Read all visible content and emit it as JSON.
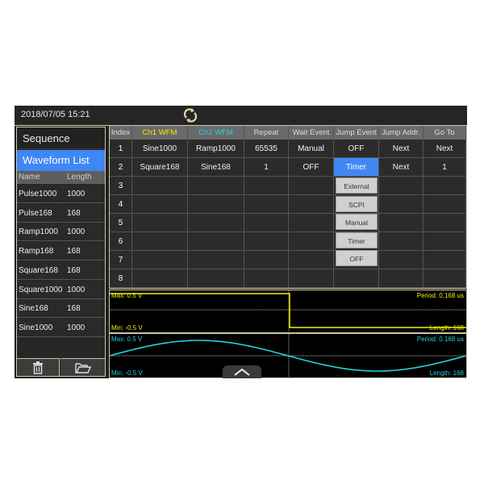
{
  "topbar": {
    "datetime": "2018/07/05 15:21",
    "refresh_icon": "refresh-icon"
  },
  "left_panel": {
    "sequence_label": "Sequence",
    "waveform_list_label": "Waveform List",
    "columns": [
      "Name",
      "Length"
    ],
    "items": [
      {
        "name": "Pulse1000",
        "length": "1000"
      },
      {
        "name": "Pulse168",
        "length": "168"
      },
      {
        "name": "Ramp1000",
        "length": "1000"
      },
      {
        "name": "Ramp168",
        "length": "168"
      },
      {
        "name": "Square168",
        "length": "168"
      },
      {
        "name": "Square1000",
        "length": "1000"
      },
      {
        "name": "Sine168",
        "length": "168"
      },
      {
        "name": "Sine1000",
        "length": "1000"
      }
    ],
    "buttons": [
      {
        "icon": "trash-icon"
      },
      {
        "icon": "folder-open-icon"
      }
    ]
  },
  "sequence_table": {
    "columns": [
      "Index",
      "Ch1 WFM",
      "Ch2 WFM",
      "Repeat",
      "Wait Event",
      "Jump Event",
      "Jump Addr.",
      "Go To"
    ],
    "column_colors": {
      "Ch1 WFM": "#f0f000",
      "Ch2 WFM": "#22d3e0"
    },
    "rows": [
      [
        "1",
        "Sine1000",
        "Ramp1000",
        "65535",
        "Manual",
        "OFF",
        "Next",
        "Next"
      ],
      [
        "2",
        "Square168",
        "Sine168",
        "1",
        "OFF",
        "Timer",
        "Next",
        "1"
      ],
      [
        "3",
        "",
        "",
        "",
        "",
        "",
        "",
        ""
      ],
      [
        "4",
        "",
        "",
        "",
        "",
        "",
        "",
        ""
      ],
      [
        "5",
        "",
        "",
        "",
        "",
        "",
        "",
        ""
      ],
      [
        "6",
        "",
        "",
        "",
        "",
        "",
        "",
        ""
      ],
      [
        "7",
        "",
        "",
        "",
        "",
        "",
        "",
        ""
      ],
      [
        "8",
        "",
        "",
        "",
        "",
        "",
        "",
        ""
      ]
    ],
    "selected_cell": {
      "row": 2,
      "column": "Jump Event",
      "value": "Timer"
    },
    "jump_event_dropdown": [
      "External",
      "SCPI",
      "Manual",
      "Timer",
      "OFF"
    ]
  },
  "ch1_preview": {
    "max": "Max: 0.5 V",
    "min": "Min: -0.5 V",
    "period": "Period: 0.168 us",
    "length": "Length: 168",
    "color": "#f0f000"
  },
  "ch2_preview": {
    "max": "Max: 0.5 V",
    "min": "Min: -0.5 V",
    "period": "Period: 0.168 us",
    "length": "Length: 168",
    "color": "#22d3e0"
  },
  "collapse_button_icon": "chevron-up-icon"
}
